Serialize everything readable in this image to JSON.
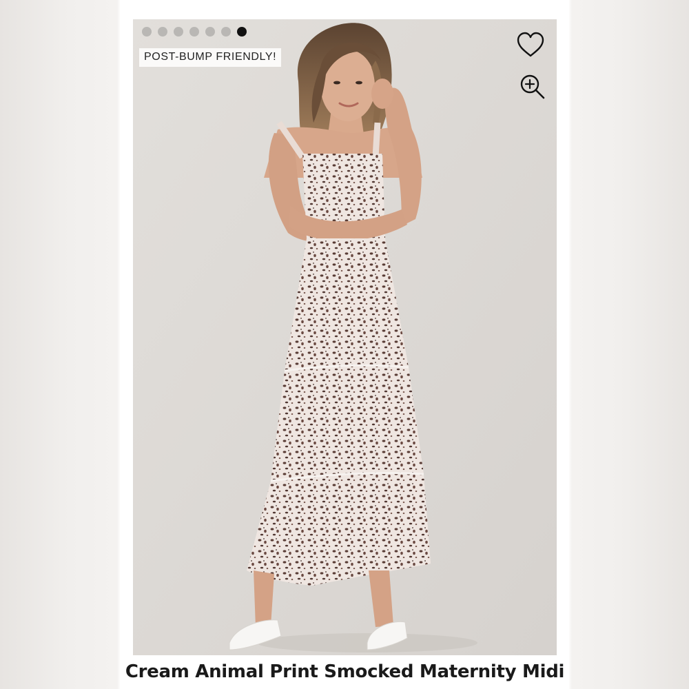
{
  "gallery": {
    "dot_count": 7,
    "active_index": 6,
    "badge": "POST-BUMP FRIENDLY!"
  },
  "icons": {
    "favorite": "heart-icon",
    "zoom": "zoom-in-icon"
  },
  "product": {
    "title": "Cream Animal Print Smocked Maternity Midi"
  },
  "colors": {
    "photo_background": "#dedbd7",
    "active_dot": "#111111",
    "inactive_dot": "#b9b7b4"
  }
}
